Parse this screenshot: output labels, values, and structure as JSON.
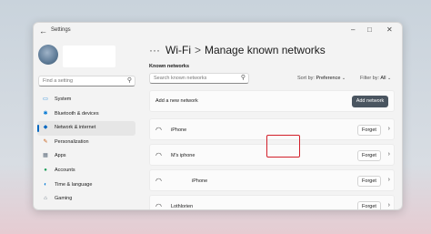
{
  "window": {
    "title": "Settings"
  },
  "sidebar": {
    "search_placeholder": "Find a setting",
    "items": [
      {
        "label": "System",
        "icon": "monitor-icon",
        "color": "#0078d4"
      },
      {
        "label": "Bluetooth & devices",
        "icon": "bluetooth-icon",
        "color": "#0078d4"
      },
      {
        "label": "Network & internet",
        "icon": "network-icon",
        "color": "#0067c0",
        "selected": true
      },
      {
        "label": "Personalization",
        "icon": "brush-icon",
        "color": "#c75b12"
      },
      {
        "label": "Apps",
        "icon": "apps-icon",
        "color": "#5b6b7b"
      },
      {
        "label": "Accounts",
        "icon": "person-icon",
        "color": "#1e9e5a"
      },
      {
        "label": "Time & language",
        "icon": "globe-icon",
        "color": "#0078d4"
      },
      {
        "label": "Gaming",
        "icon": "gamepad-icon",
        "color": "#5b6b7b"
      }
    ]
  },
  "main": {
    "breadcrumb": {
      "dots": "···",
      "parent": "Wi-Fi",
      "separator": ">",
      "current": "Manage known networks"
    },
    "section_label": "Known networks",
    "search_placeholder": "Search known networks",
    "sort": {
      "label": "Sort by:",
      "value": "Preference"
    },
    "filter": {
      "label": "Filter by:",
      "value": "All"
    },
    "add": {
      "label": "Add a new network",
      "button": "Add network"
    },
    "forget_label": "Forget",
    "networks": [
      {
        "name": "iPhone",
        "highlighted": true
      },
      {
        "name": "M's iphone"
      },
      {
        "name": "iPhone"
      },
      {
        "name": "Lothlorien"
      }
    ],
    "accent": "#0067c0",
    "highlight_color": "#d21f2a"
  }
}
